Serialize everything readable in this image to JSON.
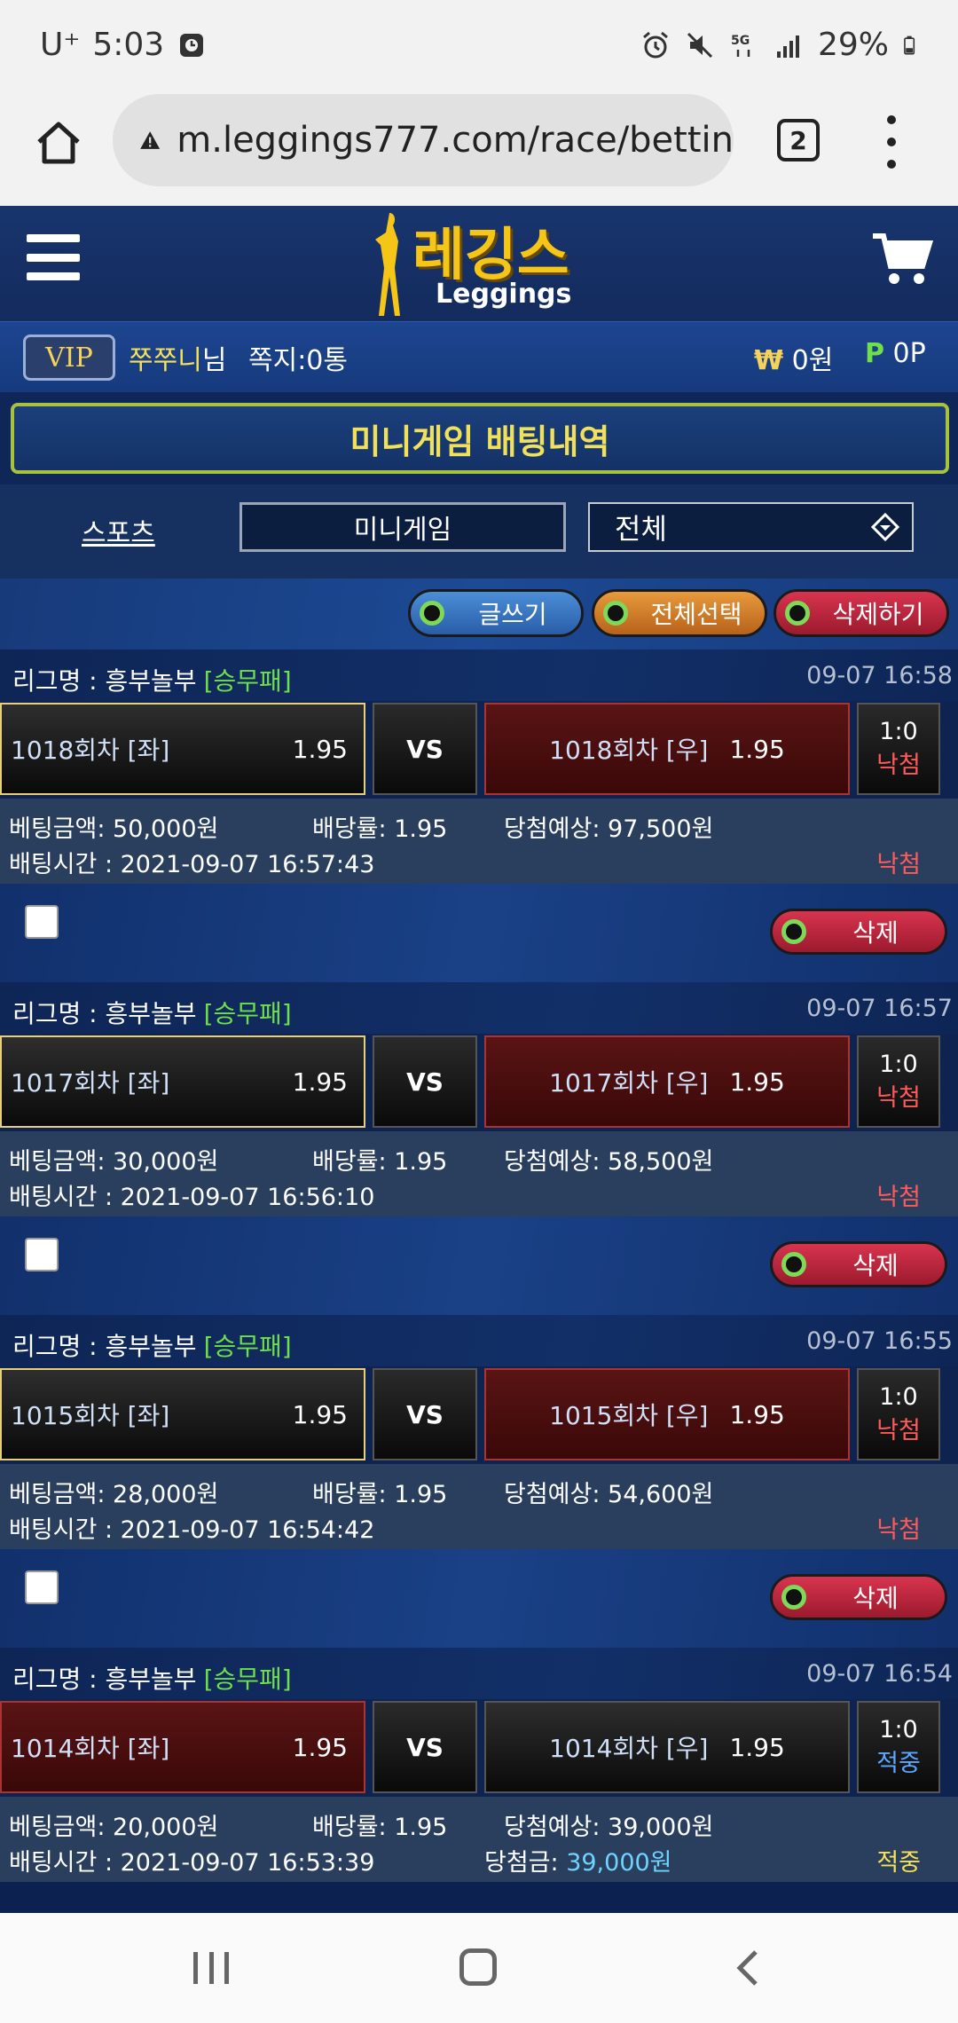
{
  "status_bar": {
    "carrier": "U⁺",
    "time": "5:03",
    "battery": "29%"
  },
  "browser": {
    "url": "m.leggings777.com/race/bettin",
    "tab_count": "2"
  },
  "header": {
    "logo_kr": "레깅스",
    "logo_en": "Leggings"
  },
  "user": {
    "level": "VIP",
    "nickname": "쭈쭈니",
    "nickname_suffix": "님",
    "messages": "쪽지:0통",
    "money_symbol": "₩",
    "money": "0원",
    "point_symbol": "P",
    "points": "0P"
  },
  "page": {
    "title": "미니게임 배팅내역"
  },
  "filter": {
    "sports_label": "스포츠",
    "minigame_label": "미니게임",
    "select_value": "전체"
  },
  "actions": {
    "write": "글쓰기",
    "select_all": "전체선택",
    "delete_all": "삭제하기"
  },
  "bets": [
    {
      "league_prefix": "리그명 : 흥부놀부",
      "league_type": "[승무패]",
      "date": "09-07 16:58",
      "left_team": "1018회차 [좌]",
      "left_odds": "1.95",
      "vs": "VS",
      "right_team": "1018회차 [우]",
      "right_odds": "1.95",
      "score": "1:0",
      "result": "낙첨",
      "amount_label": "베팅금액: 50,000원",
      "rate_label": "배당률: 1.95",
      "expected_label": "당첨예상: 97,500원",
      "time_label": "배팅시간 : 2021-09-07 16:57:43",
      "status": "낙첨",
      "delete": "삭제"
    },
    {
      "league_prefix": "리그명 : 흥부놀부",
      "league_type": "[승무패]",
      "date": "09-07 16:57",
      "left_team": "1017회차 [좌]",
      "left_odds": "1.95",
      "vs": "VS",
      "right_team": "1017회차 [우]",
      "right_odds": "1.95",
      "score": "1:0",
      "result": "낙첨",
      "amount_label": "베팅금액: 30,000원",
      "rate_label": "배당률: 1.95",
      "expected_label": "당첨예상: 58,500원",
      "time_label": "배팅시간 : 2021-09-07 16:56:10",
      "status": "낙첨",
      "delete": "삭제"
    },
    {
      "league_prefix": "리그명 : 흥부놀부",
      "league_type": "[승무패]",
      "date": "09-07 16:55",
      "left_team": "1015회차 [좌]",
      "left_odds": "1.95",
      "vs": "VS",
      "right_team": "1015회차 [우]",
      "right_odds": "1.95",
      "score": "1:0",
      "result": "낙첨",
      "amount_label": "베팅금액: 28,000원",
      "rate_label": "배당률: 1.95",
      "expected_label": "당첨예상: 54,600원",
      "time_label": "배팅시간 : 2021-09-07 16:54:42",
      "status": "낙첨",
      "delete": "삭제"
    },
    {
      "league_prefix": "리그명 : 흥부놀부",
      "league_type": "[승무패]",
      "date": "09-07 16:54",
      "left_team": "1014회차 [좌]",
      "left_odds": "1.95",
      "vs": "VS",
      "right_team": "1014회차 [우]",
      "right_odds": "1.95",
      "score": "1:0",
      "result": "적중",
      "amount_label": "베팅금액: 20,000원",
      "rate_label": "배당률: 1.95",
      "expected_label": "당첨예상: 39,000원",
      "time_label": "배팅시간 : 2021-09-07 16:53:39",
      "win_label": "당첨금: ",
      "win_value": "39,000원",
      "status": "적중"
    }
  ],
  "colors": {
    "accent_green": "#6fe04a",
    "lose_red": "#ff5a5a",
    "win_yellow": "#f5e05a",
    "gold": "#f5c518"
  }
}
